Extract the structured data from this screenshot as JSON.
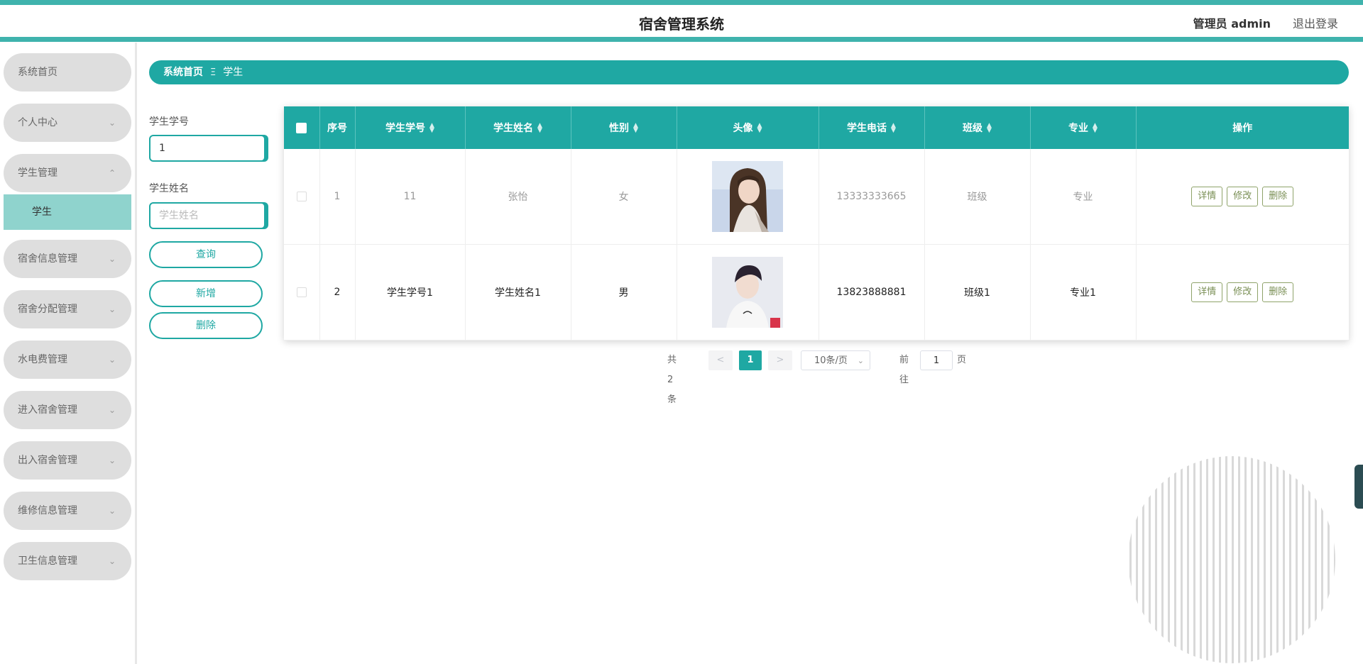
{
  "header": {
    "title": "宿舍管理系统",
    "admin_label": "管理员 admin",
    "logout": "退出登录"
  },
  "sidebar": {
    "items": [
      {
        "label": "系统首页",
        "expandable": false
      },
      {
        "label": "个人中心",
        "expandable": true
      },
      {
        "label": "学生管理",
        "expandable": true,
        "expanded": true
      },
      {
        "label": "宿舍信息管理",
        "expandable": true
      },
      {
        "label": "宿舍分配管理",
        "expandable": true
      },
      {
        "label": "水电费管理",
        "expandable": true
      },
      {
        "label": "进入宿舍管理",
        "expandable": true
      },
      {
        "label": "出入宿舍管理",
        "expandable": true
      },
      {
        "label": "维修信息管理",
        "expandable": true
      },
      {
        "label": "卫生信息管理",
        "expandable": true
      }
    ],
    "sub_item": "学生"
  },
  "breadcrumb": {
    "home": "系统首页",
    "separator": "Ξ",
    "current": "学生"
  },
  "search": {
    "id_label": "学生学号",
    "id_value": "1",
    "name_label": "学生姓名",
    "name_placeholder": "学生姓名",
    "query_button": "查询",
    "add_button": "新增",
    "delete_button": "删除"
  },
  "table": {
    "columns": [
      "序号",
      "学生学号",
      "学生姓名",
      "性别",
      "头像",
      "学生电话",
      "班级",
      "专业",
      "操作"
    ],
    "rows": [
      {
        "index": "1",
        "student_id": "11",
        "name": "张怡",
        "gender": "女",
        "avatar": "female-avatar",
        "phone": "13333333665",
        "class": "班级",
        "major": "专业"
      },
      {
        "index": "2",
        "student_id": "学生学号1",
        "name": "学生姓名1",
        "gender": "男",
        "avatar": "male-avatar",
        "phone": "13823888881",
        "class": "班级1",
        "major": "专业1"
      }
    ],
    "actions": {
      "detail": "详情",
      "edit": "修改",
      "delete": "删除"
    }
  },
  "pagination": {
    "total": "共 2 条",
    "prev": "<",
    "current_page": "1",
    "next": ">",
    "page_size": "10条/页",
    "goto_label": "前往",
    "goto_value": "1",
    "page_suffix": "页"
  },
  "colors": {
    "accent": "#1fa8a3",
    "menu_bg": "#dedede",
    "submenu_bg": "#8fd3cd"
  }
}
